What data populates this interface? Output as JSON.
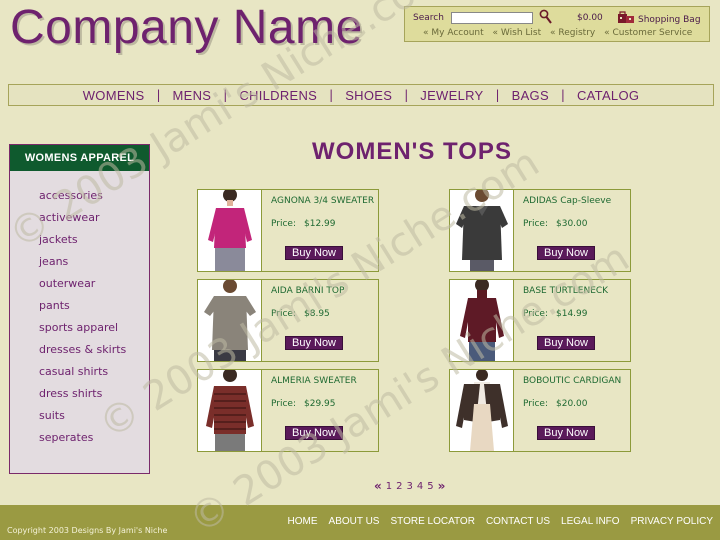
{
  "brand": {
    "name": "Company Name"
  },
  "utility": {
    "search_label": "Search",
    "search_value": "",
    "cart_total": "$0.00",
    "bag_label": "Shopping Bag",
    "links": [
      "My Account",
      "Wish List",
      "Registry",
      "Customer Service"
    ]
  },
  "nav": {
    "items": [
      "WOMENS",
      "MENS",
      "CHILDRENS",
      "SHOES",
      "JEWELRY",
      "BAGS",
      "CATALOG"
    ]
  },
  "sidebar": {
    "title": "WOMENS APPAREL",
    "items": [
      "accessories",
      "activewear",
      "jackets",
      "jeans",
      "outerwear",
      "pants",
      "sports apparel",
      "dresses & skirts",
      "casual shirts",
      "dress shirts",
      "suits",
      "seperates"
    ]
  },
  "main": {
    "heading": "WOMEN'S  TOPS",
    "price_label": "Price:",
    "buy_label": "Buy Now",
    "products": [
      {
        "name": "AGNONA 3/4 SWEATER",
        "price": "$12.99",
        "image": "pink-top"
      },
      {
        "name": "ADIDAS Cap-Sleeve",
        "price": "$30.00",
        "image": "dark-polo"
      },
      {
        "name": "AIDA BARNI TOP",
        "price": "$8.95",
        "image": "grey-tee"
      },
      {
        "name": "BASE TURTLENECK",
        "price": "$14.99",
        "image": "maroon-turtleneck"
      },
      {
        "name": "ALMERIA SWEATER",
        "price": "$29.95",
        "image": "striped-sweater"
      },
      {
        "name": "BOBOUTIC CARDIGAN",
        "price": "$20.00",
        "image": "brown-cardigan"
      }
    ],
    "pager": {
      "prev": "«",
      "pages": [
        "1",
        "2",
        "3",
        "4",
        "5"
      ],
      "next": "»"
    }
  },
  "footer": {
    "copyright": "Copyright 2003 Designs By Jami's Niche",
    "links": [
      "HOME",
      "ABOUT US",
      "STORE LOCATOR",
      "CONTACT US",
      "LEGAL INFO",
      "PRIVACY POLICY"
    ]
  },
  "watermark": {
    "text": "© 2003 Jami's Niche.com"
  },
  "colors": {
    "background": "#e8e6c4",
    "accent": "#6e226e",
    "sidebar_header": "#0f5a2e",
    "footer": "#9a9a42",
    "buy_button": "#5a1a5a"
  }
}
